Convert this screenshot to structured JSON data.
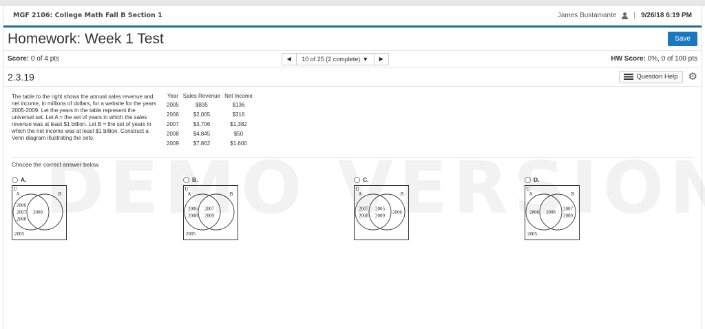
{
  "course": "MGF 2106: College Math Fall B Section 1",
  "user": "James Bustamante",
  "datetime": "9/26/18 6:19 PM",
  "title": "Homework: Week 1 Test",
  "save_label": "Save",
  "score": {
    "label": "Score:",
    "value": "0 of 4 pts"
  },
  "nav": {
    "position": "10 of 25 (2 complete)"
  },
  "hw_score": {
    "label": "HW Score:",
    "value": "0%, 0 of 100 pts"
  },
  "question_number": "2.3.19",
  "help_label": "Question Help",
  "problem_text": "The table to the right shows the annual sales revenue and net income, in millions of dollars, for a website for the years 2005-2009. Let the years in the table represent the universal set. Let A = the set of years in which the sales revenue was at least $1 billion. Let B = the set of years in which the net income was at least $1 billion. Construct a Venn diagram illustrating the sets.",
  "table": {
    "headers": [
      "Year",
      "Sales Revenue",
      "Net Income"
    ],
    "rows": [
      [
        "2005",
        "$835",
        "$136"
      ],
      [
        "2006",
        "$2,005",
        "$316"
      ],
      [
        "2007",
        "$3,706",
        "$1,382"
      ],
      [
        "2008",
        "$4,845",
        "$50"
      ],
      [
        "2009",
        "$7,862",
        "$1,600"
      ]
    ]
  },
  "prompt": "Choose the correct answer below.",
  "watermark": "DEMO VERSION",
  "venn_labels": {
    "universe": "U",
    "set_a": "A",
    "set_b": "B"
  },
  "options": [
    {
      "letter": "A.",
      "a_only": [
        "2006",
        "2007",
        "2008"
      ],
      "both": [
        "2009"
      ],
      "b_only": [],
      "outside": [
        "2005"
      ]
    },
    {
      "letter": "B.",
      "a_only": [
        "2006",
        "2008"
      ],
      "both": [
        "2007",
        "2009"
      ],
      "b_only": [],
      "outside": [
        "2005"
      ]
    },
    {
      "letter": "C.",
      "a_only": [
        "2007",
        "2008"
      ],
      "both": [
        "2005",
        "2009"
      ],
      "b_only": [
        "2006"
      ],
      "outside": []
    },
    {
      "letter": "D.",
      "a_only": [
        "2006"
      ],
      "both": [
        "2008"
      ],
      "b_only": [
        "2007",
        "2009"
      ],
      "outside": [
        "2005"
      ]
    }
  ],
  "accent_color": "#1d6b8d",
  "save_color": "#1a78c2"
}
